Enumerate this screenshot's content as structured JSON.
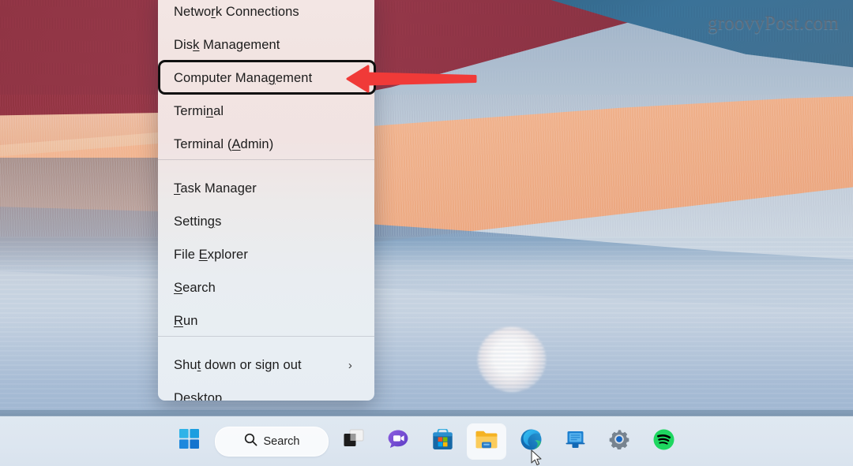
{
  "desktop": {
    "wallpaper_name": "windows-11-bloom-fabric-wallpaper",
    "watermark": "groovyPost.com",
    "colors": {
      "maroon": "#8e3342",
      "teal": "#2d5f80",
      "peach": "#f0b28f",
      "water_blue": "#a9bed5",
      "taskbar": "#dde6f0",
      "accent_red": "#f03a38",
      "annotation_border": "#101010"
    }
  },
  "winx_menu": {
    "name": "Win+X Quick Link Menu",
    "groups": [
      {
        "items": [
          {
            "label": "Network Connections",
            "accel": "w",
            "accel_index": 5,
            "has_submenu": false
          },
          {
            "label": "Disk Management",
            "accel": "k",
            "accel_index": 3,
            "has_submenu": false
          },
          {
            "label": "Computer Management",
            "accel": "g",
            "accel_index": 13,
            "has_submenu": false,
            "highlighted": true
          },
          {
            "label": "Terminal",
            "accel": "i",
            "accel_index": 5,
            "has_submenu": false
          },
          {
            "label": "Terminal (Admin)",
            "accel": "A",
            "accel_index": 10,
            "has_submenu": false
          }
        ]
      },
      {
        "items": [
          {
            "label": "Task Manager",
            "accel": "T",
            "accel_index": 0,
            "has_submenu": false
          },
          {
            "label": "Settings",
            "accel": "n",
            "accel_index": 6,
            "has_submenu": false
          },
          {
            "label": "File Explorer",
            "accel": "E",
            "accel_index": 5,
            "has_submenu": false
          },
          {
            "label": "Search",
            "accel": "S",
            "accel_index": 0,
            "has_submenu": false
          },
          {
            "label": "Run",
            "accel": "R",
            "accel_index": 0,
            "has_submenu": false
          }
        ]
      },
      {
        "items": [
          {
            "label": "Shut down or sign out",
            "accel": "u",
            "accel_index": 3,
            "has_submenu": true,
            "submenu_glyph": "›"
          },
          {
            "label": "Desktop",
            "accel": "D",
            "accel_index": 0,
            "has_submenu": false
          }
        ]
      }
    ]
  },
  "annotation": {
    "highlight_target": "Computer Management",
    "arrow_direction": "left",
    "arrow_color": "#f03a38"
  },
  "taskbar": {
    "search": {
      "label": "Search",
      "icon": "search-icon"
    },
    "items": [
      {
        "name": "start-button",
        "icon": "windows-logo-icon",
        "label": "Start",
        "active": false
      },
      {
        "name": "search-pill",
        "icon": "search-icon",
        "label": "Search",
        "active": false
      },
      {
        "name": "task-view-button",
        "icon": "task-view-icon",
        "label": "Task View",
        "active": false
      },
      {
        "name": "chat-button",
        "icon": "chat-icon",
        "label": "Chat",
        "active": false
      },
      {
        "name": "microsoft-store-button",
        "icon": "microsoft-store-icon",
        "label": "Microsoft Store",
        "active": false
      },
      {
        "name": "file-explorer-button",
        "icon": "file-explorer-icon",
        "label": "File Explorer",
        "active": true
      },
      {
        "name": "edge-button",
        "icon": "microsoft-edge-icon",
        "label": "Microsoft Edge",
        "active": false
      },
      {
        "name": "remote-desktop-button",
        "icon": "remote-desktop-icon",
        "label": "Remote Desktop",
        "active": false
      },
      {
        "name": "settings-button",
        "icon": "gear-icon",
        "label": "Settings",
        "active": false
      },
      {
        "name": "spotify-button",
        "icon": "spotify-icon",
        "label": "Spotify",
        "active": false
      }
    ]
  }
}
